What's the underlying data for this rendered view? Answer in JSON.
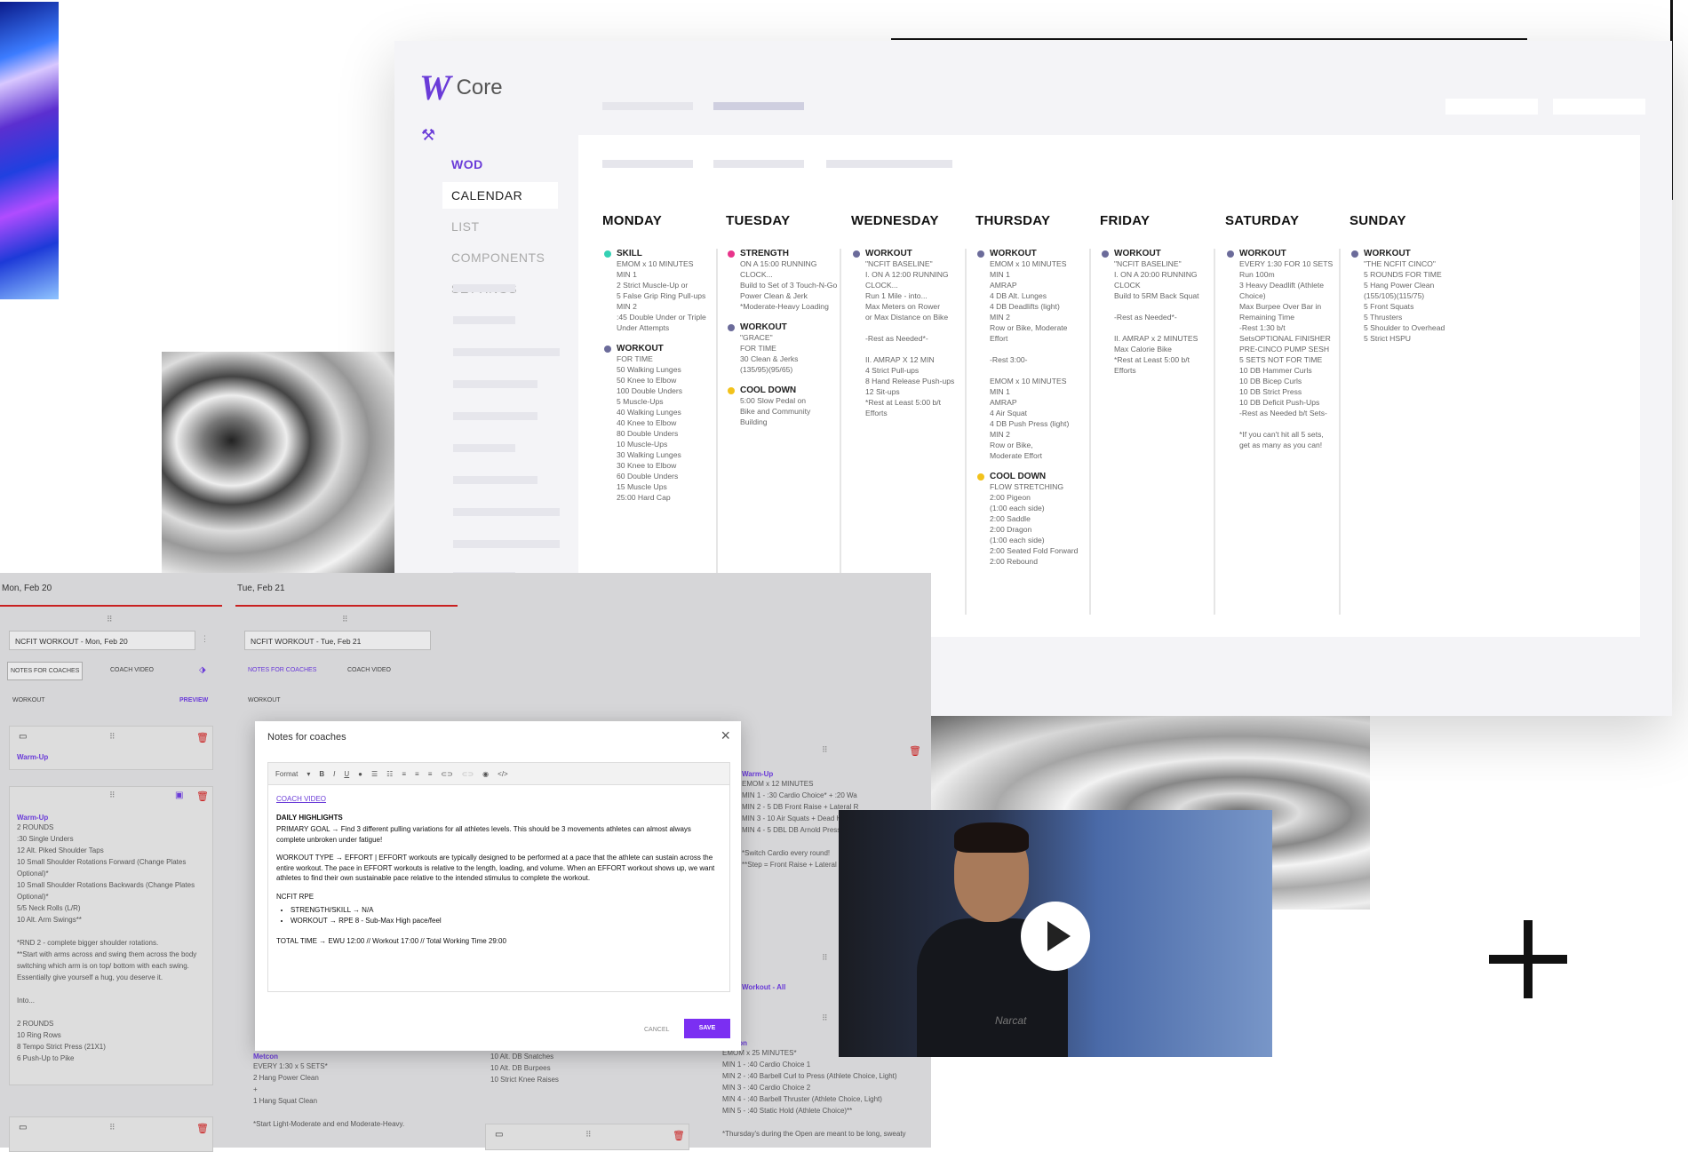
{
  "app": {
    "logo_letter": "W",
    "logo_text": "Core",
    "accent": "#6a3bd8"
  },
  "nav": {
    "items": [
      {
        "label": "WOD",
        "active": true
      },
      {
        "label": "CALENDAR",
        "selected": true
      },
      {
        "label": "LIST"
      },
      {
        "label": "COMPONENTS"
      },
      {
        "label": "SETTINGS"
      }
    ]
  },
  "calendar": {
    "days": [
      {
        "name": "MONDAY",
        "blocks": [
          {
            "title": "SKILL",
            "color": "#34d1b4",
            "lines": [
              "EMOM x 10 MINUTES",
              "MIN 1",
              "2 Strict Muscle-Up or",
              "5 False Grip Ring Pull-ups",
              "MIN 2",
              ":45 Double Under or Triple",
              "Under Attempts"
            ]
          },
          {
            "title": "WORKOUT",
            "color": "#6b6b9a",
            "lines": [
              "FOR TIME",
              "50 Walking Lunges",
              "50 Knee to Elbow",
              "100 Double Unders",
              "5 Muscle-Ups",
              "40 Walking Lunges",
              "40 Knee to Elbow",
              "80 Double Unders",
              "10 Muscle-Ups",
              "30 Walking Lunges",
              "30 Knee to Elbow",
              "60 Double Unders",
              "15 Muscle Ups",
              "25:00 Hard Cap"
            ]
          }
        ]
      },
      {
        "name": "TUESDAY",
        "blocks": [
          {
            "title": "STRENGTH",
            "color": "#e8338a",
            "lines": [
              "ON A 15:00 RUNNING",
              "CLOCK...",
              "Build to Set of 3 Touch-N-Go",
              "Power Clean & Jerk",
              "*Moderate-Heavy Loading"
            ]
          },
          {
            "title": "WORKOUT",
            "color": "#6b6b9a",
            "lines": [
              "\"GRACE\"",
              "FOR TIME",
              "30 Clean & Jerks",
              "(135/95)(95/65)"
            ]
          },
          {
            "title": "COOL DOWN",
            "color": "#f2c21b",
            "lines": [
              "5:00 Slow Pedal on",
              "Bike and Community",
              "Building"
            ]
          }
        ]
      },
      {
        "name": "WEDNESDAY",
        "blocks": [
          {
            "title": "WORKOUT",
            "color": "#6b6b9a",
            "lines": [
              "\"NCFIT BASELINE\"",
              "I. ON A 12:00 RUNNING",
              "CLOCK...",
              "Run 1 Mile - into...",
              "Max Meters on Rower",
              "or Max Distance on Bike",
              "",
              "-Rest as Needed*-",
              "",
              "II. AMRAP X 12 MIN",
              "4 Strict Pull-ups",
              "8 Hand Release Push-ups",
              "12 Sit-ups",
              "*Rest at Least 5:00 b/t",
              "Efforts"
            ]
          }
        ]
      },
      {
        "name": "THURSDAY",
        "blocks": [
          {
            "title": "WORKOUT",
            "color": "#6b6b9a",
            "lines": [
              "EMOM x 10 MINUTES",
              "MIN 1",
              "AMRAP",
              "4 DB Alt. Lunges",
              "4 DB Deadlifts (light)",
              "MIN 2",
              "Row or Bike, Moderate",
              "Effort",
              "",
              "-Rest 3:00-",
              "",
              "EMOM x 10 MINUTES",
              "MIN 1",
              "AMRAP",
              "4 Air Squat",
              "4 DB Push Press (light)",
              "MIN 2",
              "Row or Bike,",
              "Moderate Effort"
            ]
          },
          {
            "title": "COOL DOWN",
            "color": "#f2c21b",
            "lines": [
              "FLOW STRETCHING",
              "2:00 Pigeon",
              "(1:00 each side)",
              "2:00 Saddle",
              "2:00 Dragon",
              "(1:00 each side)",
              "2:00 Seated Fold Forward",
              "2:00 Rebound"
            ]
          }
        ]
      },
      {
        "name": "FRIDAY",
        "blocks": [
          {
            "title": "WORKOUT",
            "color": "#6b6b9a",
            "lines": [
              "\"NCFIT BASELINE\"",
              "I. ON A 20:00 RUNNING",
              "CLOCK",
              "Build to 5RM Back Squat",
              "",
              "-Rest as Needed*-",
              "",
              "II. AMRAP x 2 MINUTES",
              "Max Calorie Bike",
              "*Rest at Least 5:00 b/t",
              "Efforts"
            ]
          }
        ]
      },
      {
        "name": "SATURDAY",
        "blocks": [
          {
            "title": "WORKOUT",
            "color": "#6b6b9a",
            "lines": [
              "EVERY 1:30 FOR 10 SETS",
              "Run 100m",
              "3 Heavy Deadlift (Athlete",
              "Choice)",
              "Max Burpee Over Bar in",
              "Remaining Time",
              "-Rest 1:30 b/t",
              "SetsOPTIONAL FINISHER",
              "PRE-CINCO PUMP SESH",
              "5 SETS NOT FOR TIME",
              "10 DB Hammer Curls",
              "10 DB Bicep Curls",
              "10 DB Strict Press",
              "10 DB Deficit Push-Ups",
              "-Rest as Needed b/t Sets-",
              "",
              "*If you can't hit all 5 sets,",
              "get as many as you can!"
            ]
          }
        ]
      },
      {
        "name": "SUNDAY",
        "blocks": [
          {
            "title": "WORKOUT",
            "color": "#6b6b9a",
            "lines": [
              "\"THE NCFIT CINCO\"",
              "5 ROUNDS FOR TIME",
              "5 Hang Power Clean",
              "(155/105)(115/75)",
              "5 Front Squats",
              "5 Thrusters",
              "5 Shoulder to Overhead",
              "5 Strict HSPU"
            ]
          }
        ]
      }
    ]
  },
  "editor": {
    "columns": [
      {
        "date": "Mon, Feb 20",
        "input": "NCFIT WORKOUT - Mon, Feb 20",
        "tab1": "NOTES FOR COACHES",
        "tab2": "COACH VIDEO",
        "section": "WORKOUT",
        "preview": "PREVIEW",
        "card1_title": "Warm-Up",
        "card2_title": "Warm-Up",
        "card2_lines": [
          "2 ROUNDS",
          ":30 Single Unders",
          "12 Alt. Piked Shoulder Taps",
          "10 Small Shoulder Rotations Forward (Change Plates",
          "Optional)*",
          "10 Small Shoulder Rotations Backwards (Change Plates",
          "Optional)*",
          "5/5 Neck Rolls (L/R)",
          "10 Alt. Arm Swings**",
          "",
          "*RND 2 - complete bigger shoulder rotations.",
          "**Start with arms across and swing them across the body",
          "switching which arm is on top/ bottom with each swing.",
          "Essentially give yourself a hug, you deserve it.",
          "",
          "Into...",
          "",
          "2 ROUNDS",
          "10 Ring Rows",
          "8 Tempo Strict Press (21X1)",
          "6 Push-Up to Pike"
        ]
      },
      {
        "date": "Tue, Feb 21",
        "input": "NCFIT WORKOUT - Tue, Feb 21",
        "tab1": "NOTES FOR COACHES",
        "tab2": "COACH VIDEO",
        "section": "WORKOUT",
        "card_title": "Metcon",
        "card_lines": [
          "EVERY 1:30 x 5 SETS*",
          "2 Hang Power Clean",
          "+",
          "1 Hang Squat Clean",
          "",
          "*Start Light-Moderate and end Moderate-Heavy."
        ]
      },
      {
        "card_lines": [
          "10 Alt. DB Snatches",
          "10 Alt. DB Burpees",
          "10 Strict Knee Raises"
        ]
      },
      {
        "card1_title": "Warm-Up",
        "card1_lines": [
          "EMOM x 12 MINUTES",
          "MIN 1 - :30 Cardio Choice* + :20 Wa",
          "MIN 2 - 5 DB Front Raise + Lateral R",
          "MIN 3 - 10 Air Squats + Dead Hang",
          "MIN 4 - 5 DBL DB Arnold Press + :2",
          "",
          "*Switch Cardio every round!",
          "**Step = Front Raise + Lateral Rais"
        ],
        "card2_title": "Workout - All",
        "card3_title": "Metcon",
        "card3_lines": [
          "EMOM x 25 MINUTES*",
          "MIN 1 - :40 Cardio Choice 1",
          "MIN 2 - :40 Barbell Curl to Press (Athlete Choice, Light)",
          "MIN 3 - :40 Cardio Choice 2",
          "MIN 4 - :40 Barbell Thruster (Athlete Choice, Light)",
          "MIN 5 - :40 Static Hold (Athlete Choice)**",
          "",
          "*Thursday's during the Open are meant to be long, sweaty"
        ]
      }
    ]
  },
  "modal": {
    "title": "Notes for coaches",
    "close": "×",
    "toolbar": {
      "format": "Format",
      "bold": "B",
      "italic": "I",
      "underline": "U"
    },
    "link": "COACH VIDEO",
    "heading": "DAILY HIGHLIGHTS",
    "p1": "PRIMARY GOAL → Find 3 different pulling variations for all athletes levels. This should be 3 movements athletes can almost always complete unbroken under fatigue!",
    "p2": "WORKOUT TYPE → EFFORT | EFFORT workouts are typically designed to be performed at a pace that the athlete can sustain across the entire workout. The pace in EFFORT workouts is relative to the length, loading, and volume. When an EFFORT workout shows up, we want athletes to find their own sustainable pace relative to the intended stimulus to complete the workout.",
    "rpe_title": "NCFIT RPE",
    "rpe1": "STRENGTH/SKILL → N/A",
    "rpe2": "WORKOUT → RPE 8 - Sub-Max High pace/feel",
    "total": "TOTAL TIME → EWU 12:00 // Workout 17:00 // Total Working Time 29:00",
    "cancel": "CANCEL",
    "save": "SAVE"
  },
  "video": {
    "brand": "Narcat"
  }
}
